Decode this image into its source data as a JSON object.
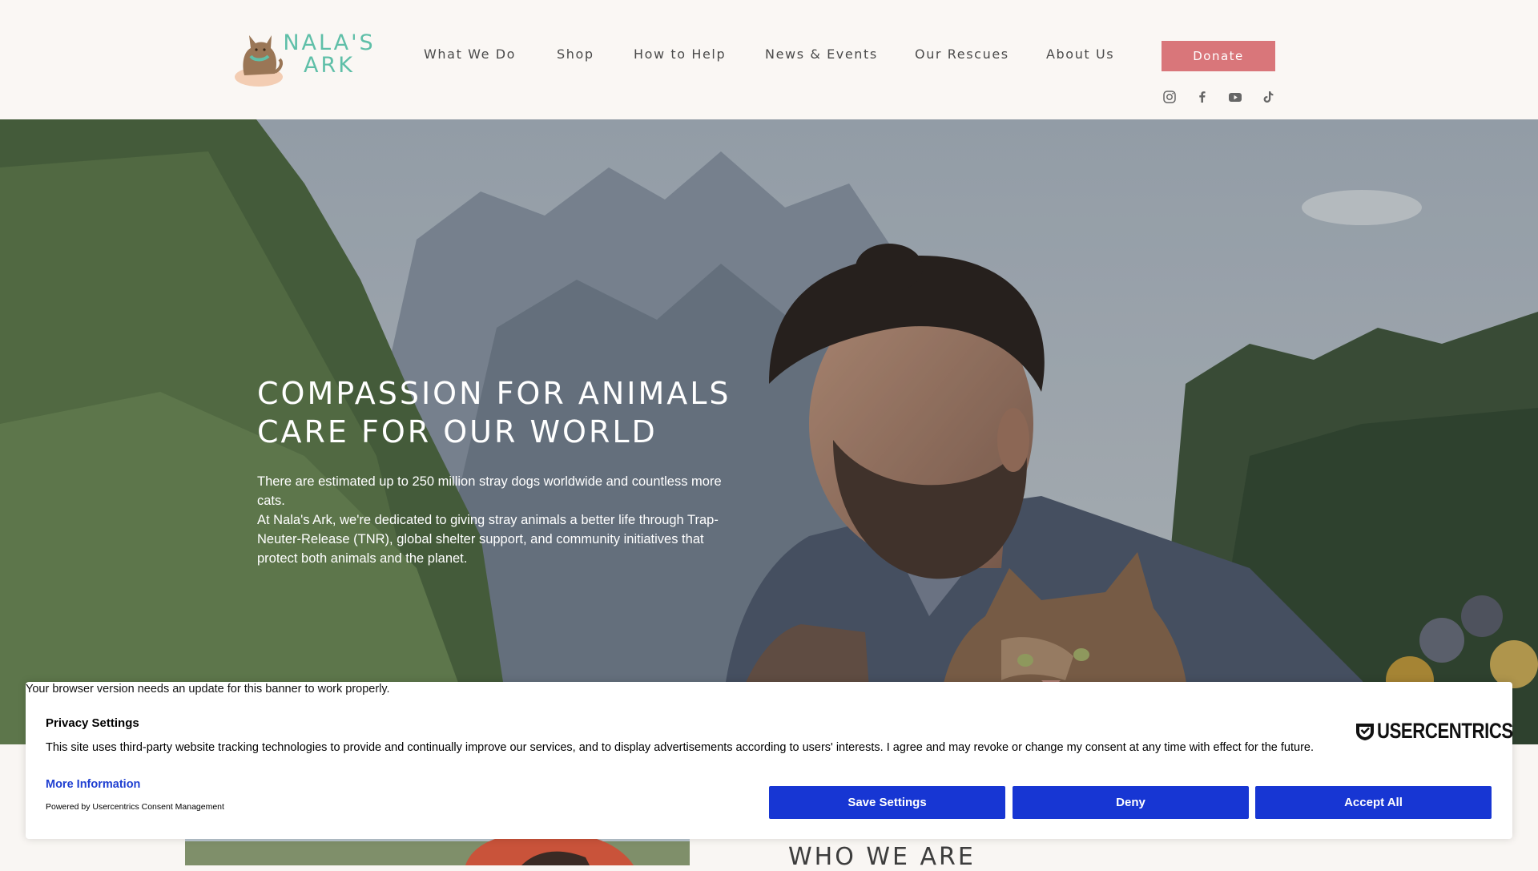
{
  "brand": {
    "line1": "NALA'S",
    "line2": "ARK",
    "color": "#5fbfa8"
  },
  "nav": {
    "items": [
      {
        "label": "What We Do"
      },
      {
        "label": "Shop"
      },
      {
        "label": "How to Help"
      },
      {
        "label": "News & Events"
      },
      {
        "label": "Our Rescues"
      },
      {
        "label": "About Us"
      }
    ],
    "donate_label": "Donate",
    "donate_color": "#d9767a"
  },
  "socials": [
    "instagram-icon",
    "facebook-icon",
    "youtube-icon",
    "tiktok-icon"
  ],
  "hero": {
    "title_line1": "COMPASSION FOR ANIMALS",
    "title_line2": "CARE FOR OUR WORLD",
    "paragraph1": "There are estimated up to 250 million stray dogs worldwide and countless more cats.",
    "paragraph2": "At Nala's Ark, we're dedicated to giving stray animals a better life through Trap-Neuter-Release (TNR), global shelter support, and community initiatives that protect both animals and the planet."
  },
  "section": {
    "who_title": "WHO WE ARE"
  },
  "consent": {
    "warning": "Your browser version needs an update for this banner to work properly.",
    "title": "Privacy Settings",
    "description": "This site uses third-party website tracking technologies to provide and continually improve our services, and to display advertisements according to users' interests. I agree and may revoke or change my consent at any time with effect for the future.",
    "more_info": "More Information",
    "powered_by": "Powered by Usercentrics Consent Management",
    "logo_text": "USERCENTRICS",
    "buttons": {
      "save": "Save Settings",
      "deny": "Deny",
      "accept": "Accept All"
    },
    "button_color": "#1736d3"
  }
}
